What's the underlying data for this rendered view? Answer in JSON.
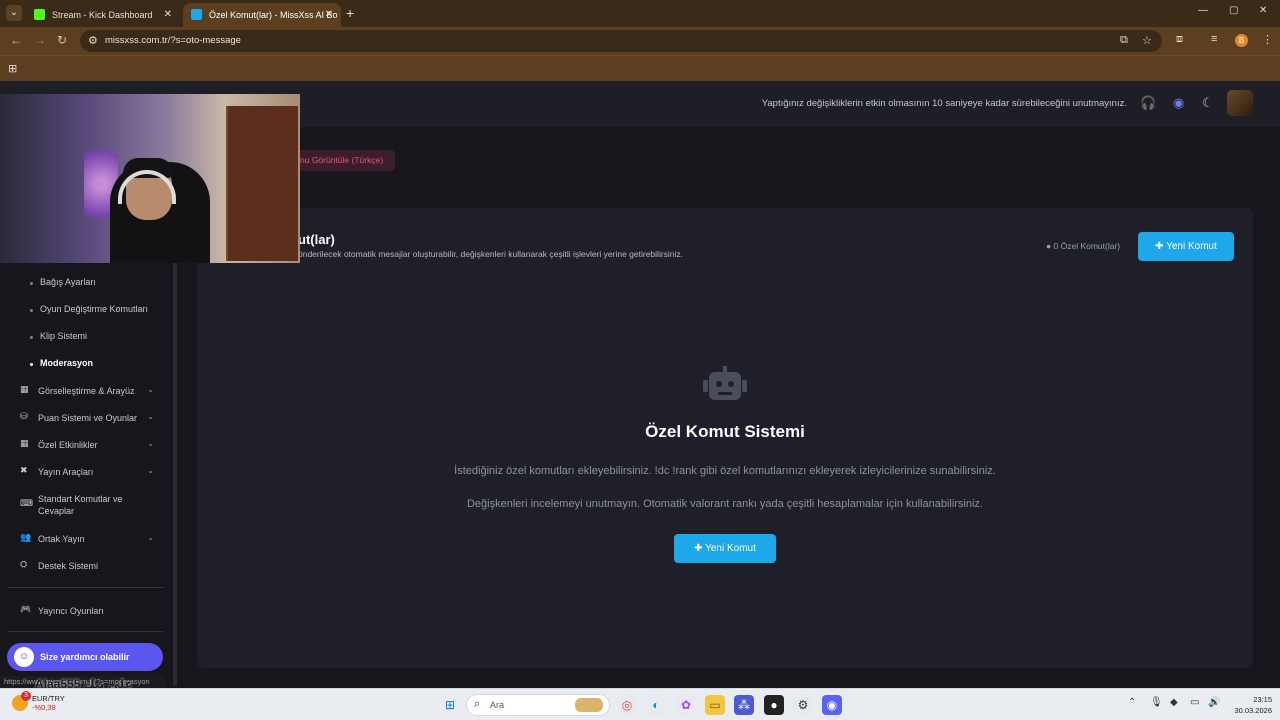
{
  "browser": {
    "tabs": [
      {
        "title": "Stream - Kick Dashboard",
        "active": false,
        "favicon_color": "#53fc18"
      },
      {
        "title": "Özel Komut(lar) - MissXss AI Bo",
        "active": true,
        "favicon_color": "#1ea7e9"
      }
    ],
    "url": "missxss.com.tr/?s=oto-message",
    "profile_initial": "B"
  },
  "header": {
    "notice": "Yaptığınız değişikliklerin etkin olmasının 10 saniyeye kadar sürebileceğini unutmayınız."
  },
  "lang_button": "nu Görüntüle (Türkçe)",
  "sidebar": {
    "sub_items": [
      {
        "label": "Bağış Ayarları"
      },
      {
        "label": "Oyun Değiştirme Komutları"
      },
      {
        "label": "Klip Sistemi"
      },
      {
        "label": "Moderasyon",
        "active": true
      }
    ],
    "items": [
      {
        "label": "Görselleştirme & Arayüz",
        "icon": "calendar-icon"
      },
      {
        "label": "Puan Sistemi ve Oyunlar",
        "icon": "coins-icon"
      },
      {
        "label": "Özel Etkinlikler",
        "icon": "calendar-icon"
      },
      {
        "label": "Yayın Araçları",
        "icon": "tools-icon"
      },
      {
        "label": "Standart Komutlar ve Cevaplar",
        "icon": "keyboard-icon"
      },
      {
        "label": "Ortak Yayın",
        "icon": "users-icon"
      },
      {
        "label": "Destek Sistemi",
        "icon": "support-icon"
      },
      {
        "label": "Yayıncı Oyunları",
        "icon": "gamepad-icon"
      }
    ],
    "chat_button": "Size yardımcı olabilir miyim?"
  },
  "card": {
    "title": "ut(lar)",
    "description": "önderilecek otomatik mesajlar oluşturabilir, değişkenleri kullanarak çeşitli işlevleri yerine getirebilirsiniz.",
    "count": "0 Özel Komut(lar)",
    "new_button": "Yeni Komut"
  },
  "empty_state": {
    "title": "Özel Komut Sistemi",
    "line1": "İstediğiniz özel komutları ekleyebilirsiniz. !dc !rank gibi özel komutlarınızı ekleyerek izleyicilerinize sunabilirsiniz.",
    "line2": "Değişkenleri incelemeyi unutmayın. Otomatik valorant rankı yada çeşitli hesaplamalar için kullanabilirsiniz.",
    "button": "Yeni Komut"
  },
  "status_url": "https://www.missxss.com.tr/?s=moderasyon",
  "overlay_text": "Alaa555  علي بيك",
  "taskbar": {
    "ticker_name": "EUR/TRY",
    "ticker_change": "-%0,38",
    "ticker_badge": "3",
    "search_placeholder": "Ara",
    "time": "23:15",
    "date": "30.03.2026"
  },
  "colors": {
    "accent": "#1ea7e9",
    "chat": "#5b56f0",
    "lang": "#ef4f7b"
  }
}
